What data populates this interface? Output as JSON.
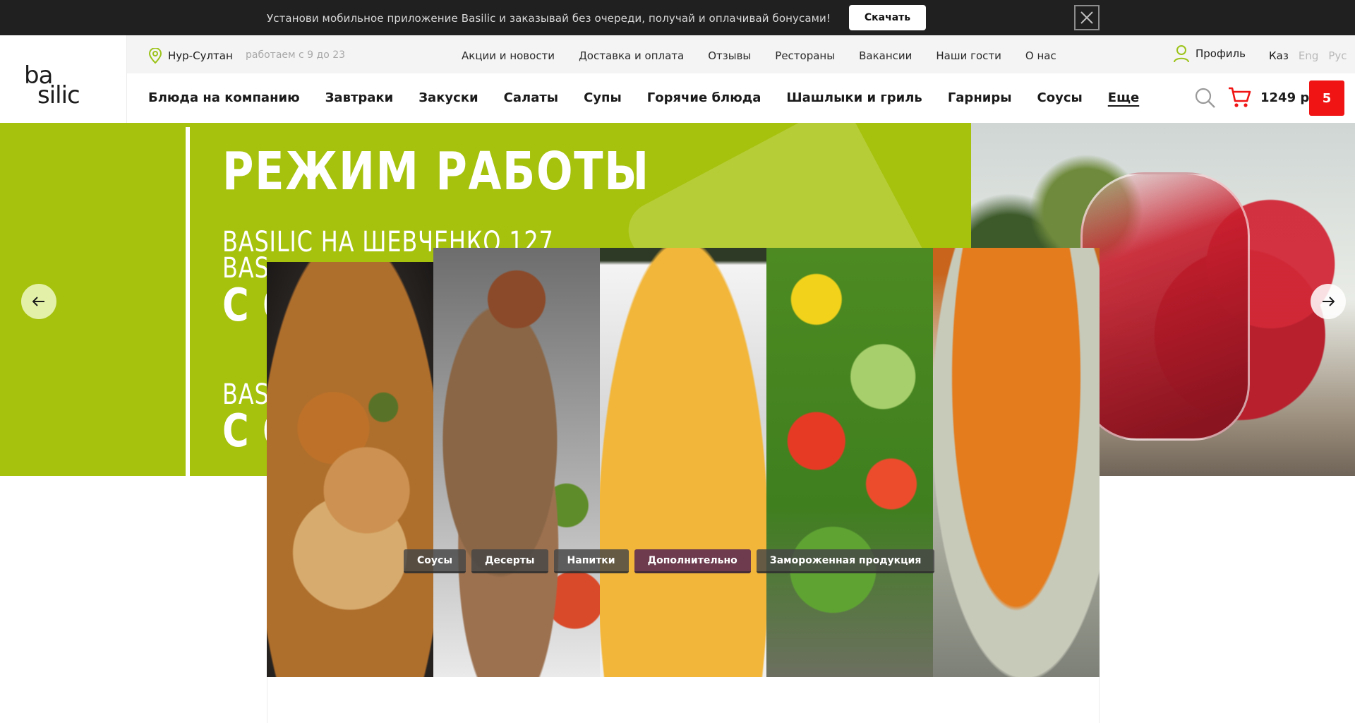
{
  "promo": {
    "text": "Установи мобильное приложение Basilic и заказывай без очереди, получай и оплачивай бонусами!",
    "button_label": "Скачать",
    "close_icon": "close-icon"
  },
  "logo": {
    "line1": "ba",
    "line2": "silic"
  },
  "info": {
    "city": "Нур-Султан",
    "hours": "работаем с 9 до 23",
    "links": [
      "Акции и новости",
      "Доставка и оплата",
      "Отзывы",
      "Рестораны",
      "Вакансии",
      "Наши гости",
      "О нас"
    ],
    "profile": "Профиль",
    "languages": [
      "Каз",
      "Eng",
      "Рус"
    ]
  },
  "nav": {
    "categories": [
      "Блюда на компанию",
      "Завтраки",
      "Закуски",
      "Салаты",
      "Супы",
      "Горячие блюда",
      "Шашлыки и гриль",
      "Гарниры",
      "Соусы"
    ],
    "more": "Еще"
  },
  "cart": {
    "sum": "1249 р",
    "count": "5"
  },
  "hero": {
    "title": "РЕЖИМ РАБОТЫ",
    "line1": "BASILIC НА ШЕВЧЕНКО 127",
    "line2": "BAS",
    "line3": "С О",
    "line4": "BAS",
    "line5": "С О"
  },
  "tags": [
    {
      "label": "Соусы",
      "active": false
    },
    {
      "label": "Десерты",
      "active": false
    },
    {
      "label": "Напитки",
      "active": false
    },
    {
      "label": "Дополнительно",
      "active": true
    },
    {
      "label": "Замороженная продукция",
      "active": false
    }
  ],
  "colors": {
    "accent_green": "#a6c20c",
    "cart_red": "#f01414",
    "active_tag": "#6e3b4e"
  }
}
